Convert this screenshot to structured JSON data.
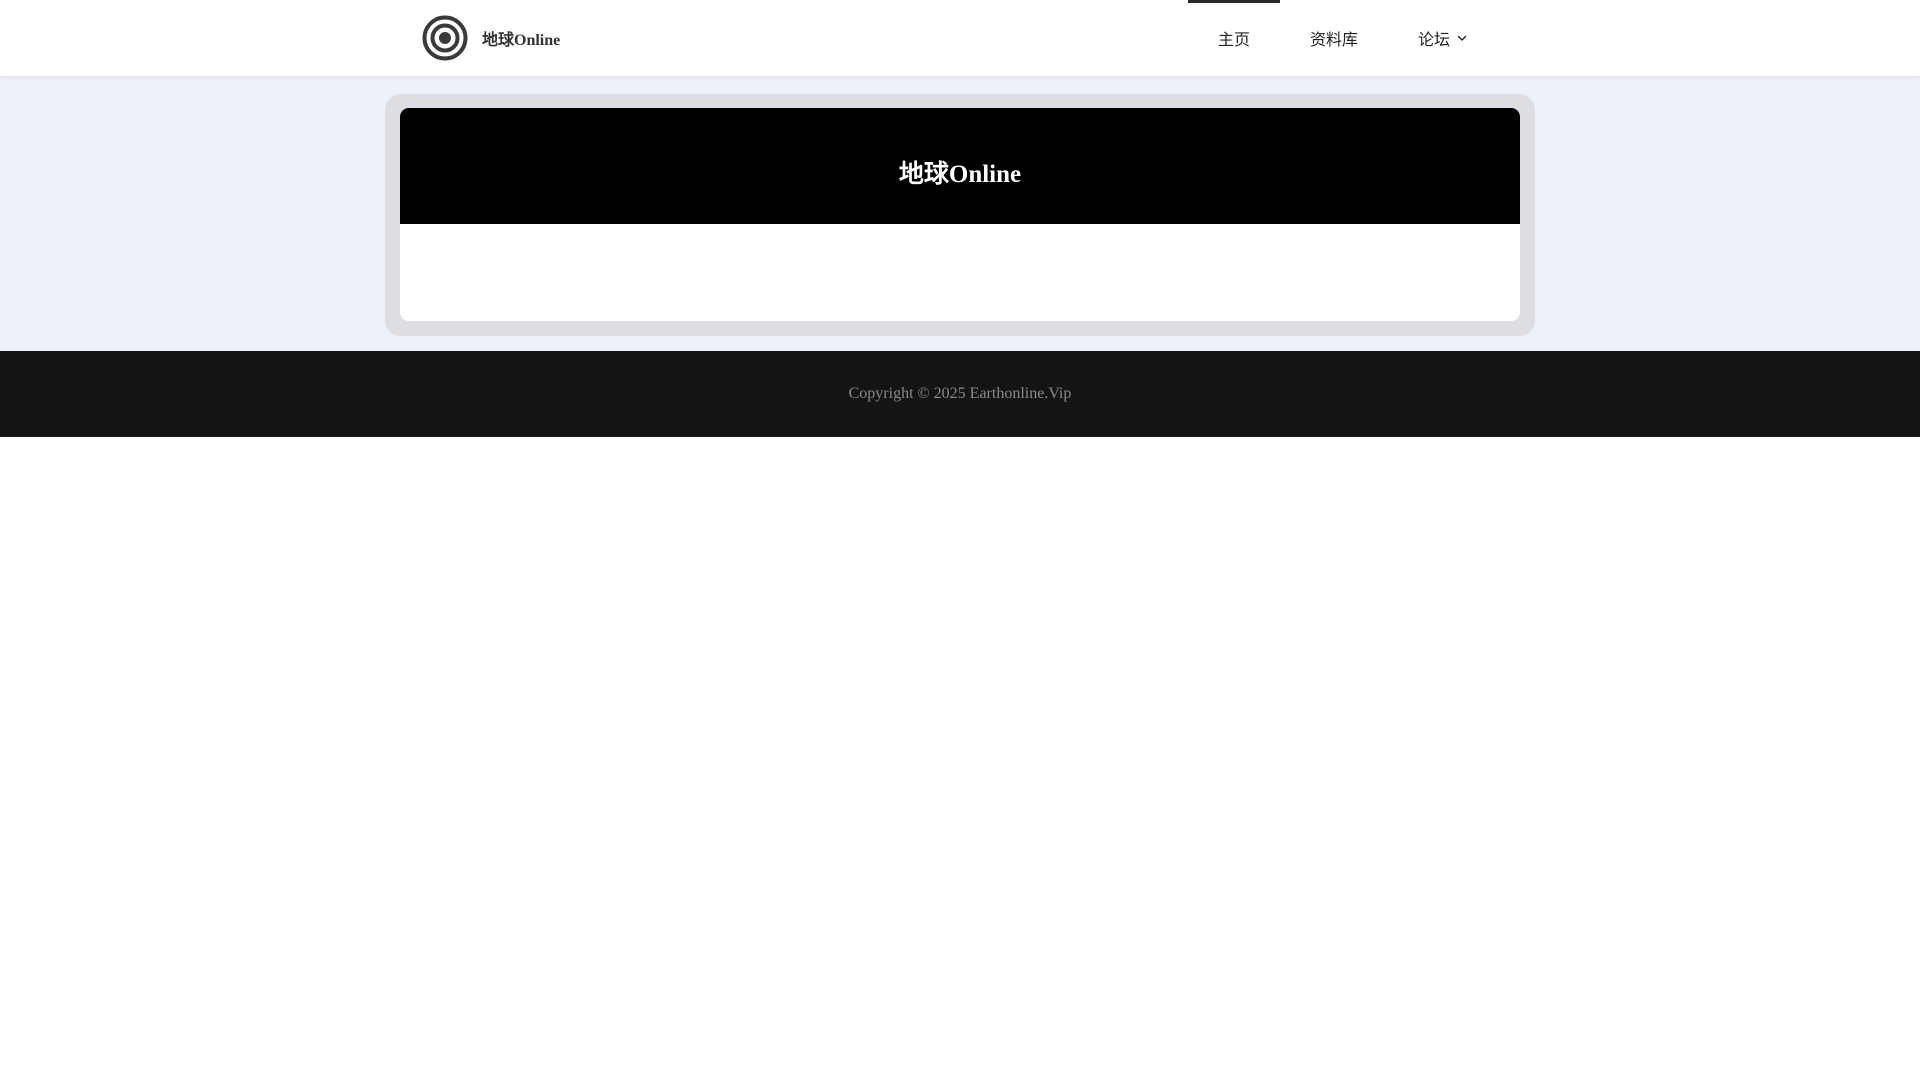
{
  "header": {
    "brand": {
      "name": "地球Online",
      "logo_icon": "concentric-circles-logo-icon"
    },
    "nav": {
      "items": [
        {
          "label": "主页",
          "active": true
        },
        {
          "label": "资料库",
          "active": false
        },
        {
          "label": "论坛",
          "active": false,
          "has_dropdown": true,
          "dropdown_icon": "chevron-down-icon"
        }
      ]
    }
  },
  "hero": {
    "title": "地球Online"
  },
  "footer": {
    "copyright": "Copyright © 2025 Earthonline.Vip"
  },
  "colors": {
    "header_bg": "#ffffff",
    "page_band_bg": "#eef1f7",
    "frame_bg": "#dddde3",
    "banner_bg": "#000000",
    "footer_bg": "#141414",
    "footer_text": "#8a8a8a",
    "nav_active_indicator": "#2b2b2b"
  }
}
